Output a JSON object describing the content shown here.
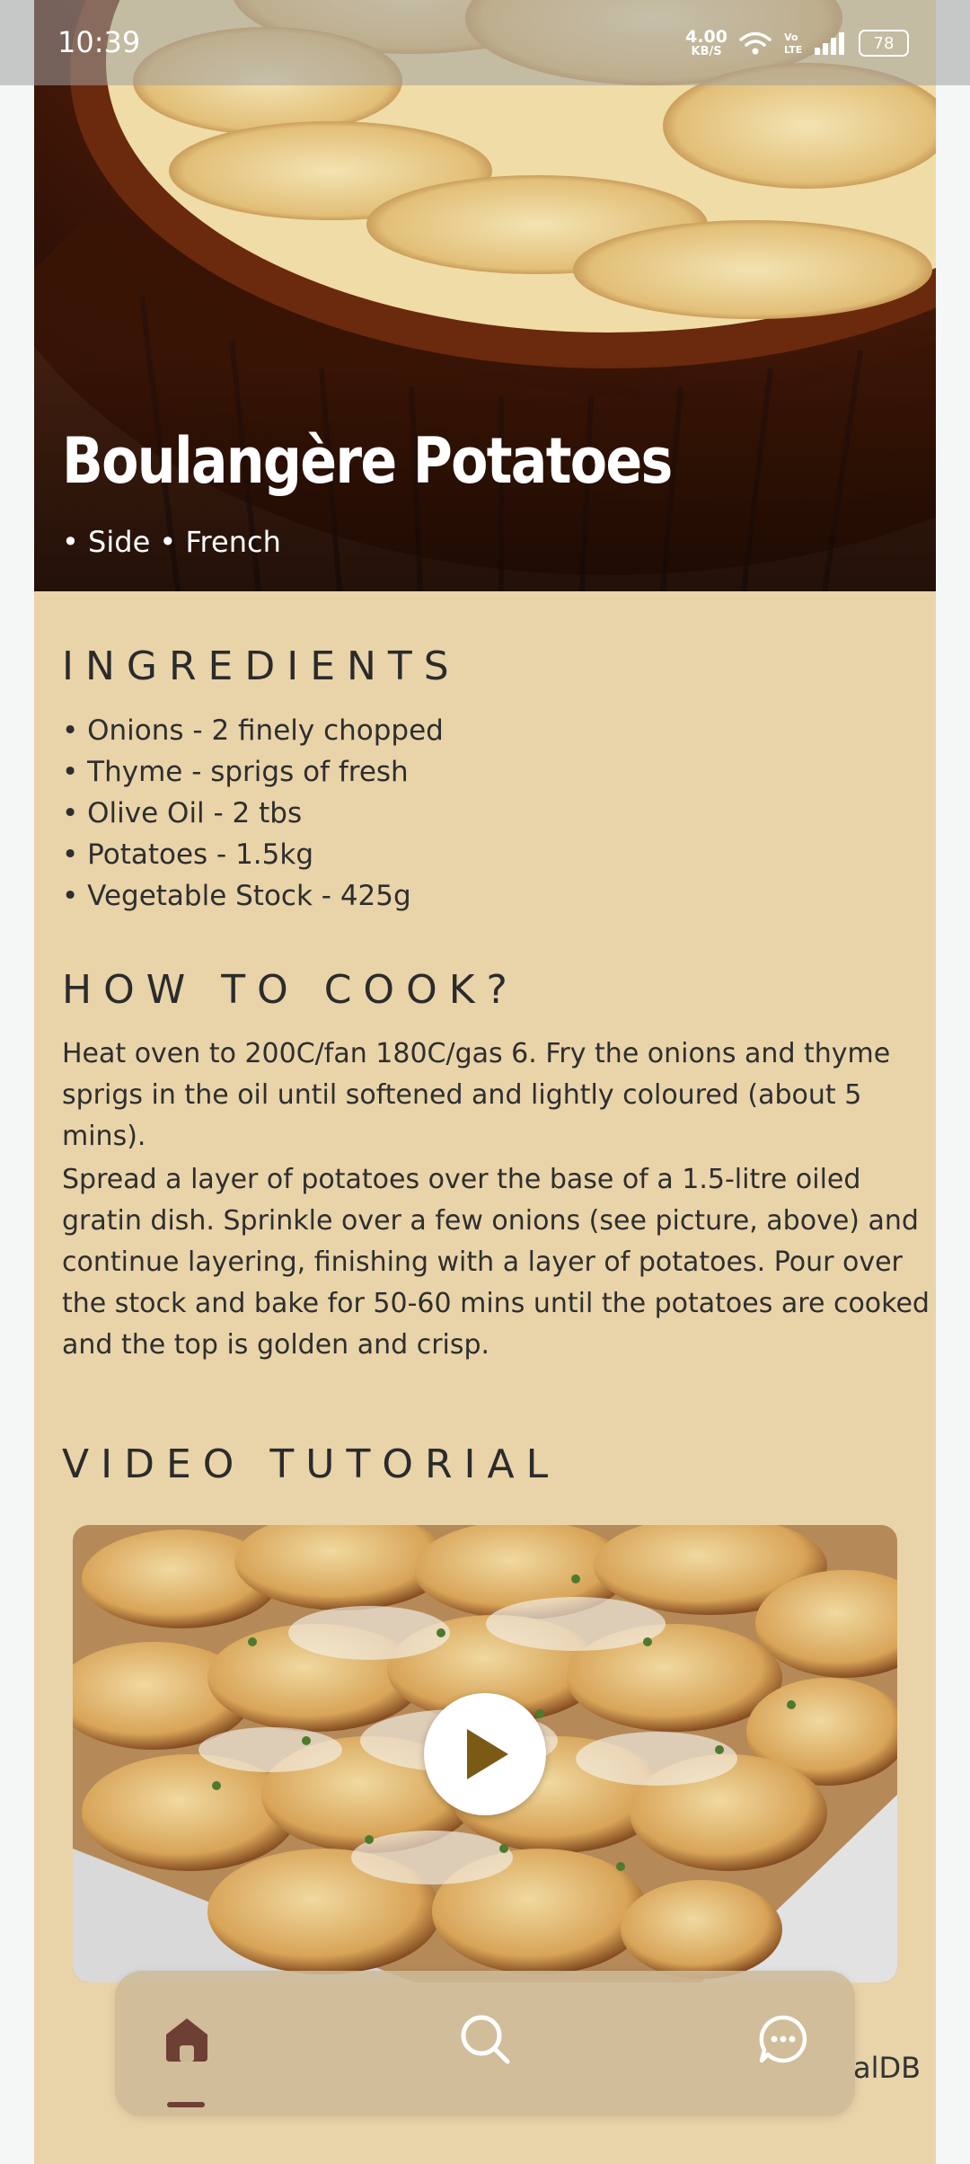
{
  "status_bar": {
    "time": "10:39",
    "net_speed_value": "4.00",
    "net_speed_unit": "KB/S",
    "volte_label": "Vo LTE",
    "battery": "78"
  },
  "recipe": {
    "title": "Boulangère Potatoes",
    "tags": "• Side • French"
  },
  "ingredients": {
    "heading": "INGREDIENTS",
    "items": [
      "• Onions - 2 finely chopped",
      "• Thyme - sprigs of fresh",
      "• Olive Oil - 2 tbs",
      "• Potatoes - 1.5kg",
      "• Vegetable Stock - 425g"
    ]
  },
  "instructions": {
    "heading": "HOW TO COOK?",
    "paragraphs": [
      "Heat oven to 200C/fan 180C/gas 6. Fry the onions and thyme sprigs in the oil until softened and lightly coloured (about 5 mins).",
      "Spread a layer of potatoes over the base of a 1.5-litre oiled gratin dish. Sprinkle over a few onions (see picture, above) and continue layering, finishing with a layer of potatoes. Pour over the stock and bake for 50-60 mins until the potatoes are cooked and the top is golden and crisp."
    ]
  },
  "video": {
    "heading": "VIDEO TUTORIAL"
  },
  "footer": {
    "credit_partial": "alDB"
  },
  "bottom_nav": {
    "items": [
      {
        "icon": "home-icon",
        "active": true
      },
      {
        "icon": "search-icon",
        "active": false
      },
      {
        "icon": "chat-icon",
        "active": false
      }
    ]
  },
  "colors": {
    "background": "#e9d3a9",
    "accent": "#6e3f35",
    "text": "#2e2e2e"
  }
}
